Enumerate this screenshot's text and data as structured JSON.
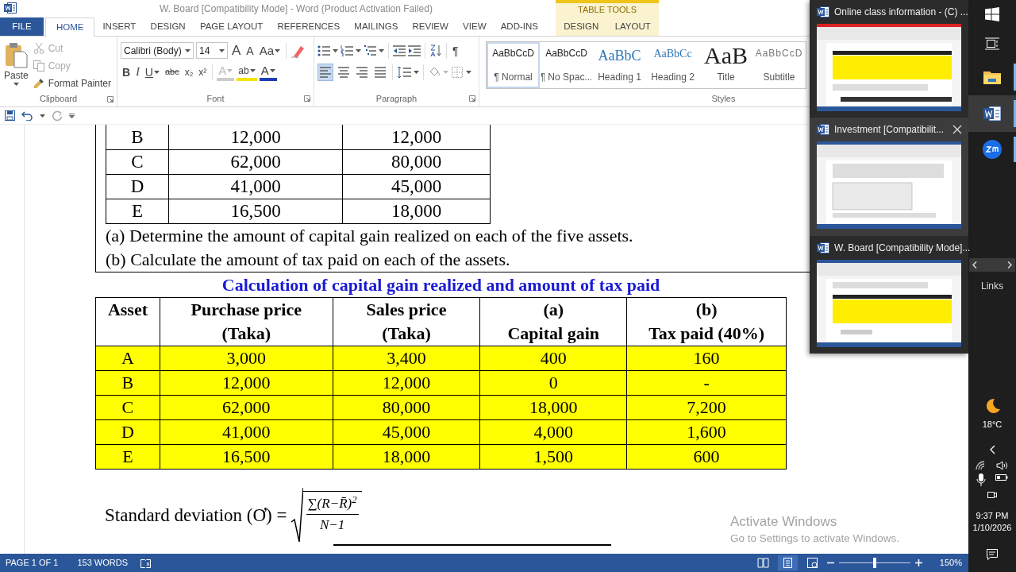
{
  "window": {
    "title": "W. Board [Compatibility Mode] - Word (Product Activation Failed)",
    "context_group": "TABLE TOOLS"
  },
  "tabs": [
    {
      "label": "FILE",
      "kind": "file",
      "selected": false
    },
    {
      "label": "HOME",
      "kind": "main",
      "selected": true
    },
    {
      "label": "INSERT",
      "kind": "main",
      "selected": false
    },
    {
      "label": "DESIGN",
      "kind": "main",
      "selected": false
    },
    {
      "label": "PAGE LAYOUT",
      "kind": "main",
      "selected": false
    },
    {
      "label": "REFERENCES",
      "kind": "main",
      "selected": false
    },
    {
      "label": "MAILINGS",
      "kind": "main",
      "selected": false
    },
    {
      "label": "REVIEW",
      "kind": "main",
      "selected": false
    },
    {
      "label": "VIEW",
      "kind": "main",
      "selected": false
    },
    {
      "label": "ADD-INS",
      "kind": "main",
      "selected": false
    },
    {
      "label": "DESIGN",
      "kind": "context",
      "selected": false
    },
    {
      "label": "LAYOUT",
      "kind": "context",
      "selected": false
    }
  ],
  "clipboard": {
    "paste": "Paste",
    "label": "Clipboard",
    "actions": [
      {
        "label": "Cut",
        "disabled": true
      },
      {
        "label": "Copy",
        "disabled": true
      },
      {
        "label": "Format Painter",
        "disabled": false
      }
    ]
  },
  "font": {
    "name": "Calibri (Body)",
    "size": "14",
    "label": "Font",
    "size_buttons": [
      "A",
      "A",
      "Aa"
    ],
    "format_buttons": [
      "B",
      "I",
      "U",
      "abc",
      "x₂",
      "x²"
    ],
    "effect_buttons": [
      "A",
      "ab",
      "A"
    ]
  },
  "paragraph": {
    "label": "Paragraph",
    "marks": "¶",
    "alignments": [
      {
        "selected": true
      },
      {
        "selected": false
      },
      {
        "selected": false
      },
      {
        "selected": false
      }
    ]
  },
  "styles": {
    "label": "Styles",
    "items": [
      {
        "sample": "AaBbCcD",
        "label": "¶ Normal",
        "kind": "normal",
        "selected": true
      },
      {
        "sample": "AaBbCcD",
        "label": "¶ No Spac...",
        "kind": "normal",
        "selected": false
      },
      {
        "sample": "AaBbC",
        "label": "Heading 1",
        "kind": "heading1",
        "selected": false
      },
      {
        "sample": "AaBbCc",
        "label": "Heading 2",
        "kind": "heading2",
        "selected": false
      },
      {
        "sample": "AaB",
        "label": "Title",
        "kind": "title",
        "selected": false
      },
      {
        "sample": "AaBbCcD",
        "label": "Subtitle",
        "kind": "subtitle",
        "selected": false
      }
    ]
  },
  "document": {
    "top_table": {
      "rows": [
        [
          "B",
          "12,000",
          "12,000"
        ],
        [
          "C",
          "62,000",
          "80,000"
        ],
        [
          "D",
          "41,000",
          "45,000"
        ],
        [
          "E",
          "16,500",
          "18,000"
        ]
      ]
    },
    "questions": [
      "(a) Determine the amount of capital gain realized on each of the five assets.",
      "(b) Calculate the amount of tax paid on each of the assets."
    ],
    "heading": "Calculation of capital gain realized and amount of tax paid",
    "table": {
      "highlighted": true,
      "header_rows": [
        [
          {
            "text": "Asset",
            "rowspan": 2
          },
          {
            "text": "Purchase price"
          },
          {
            "text": "Sales price"
          },
          {
            "text": "(a)"
          },
          {
            "text": "(b)"
          }
        ],
        [
          {
            "text": "(Taka)"
          },
          {
            "text": "(Taka)"
          },
          {
            "text": "Capital gain"
          },
          {
            "text": "Tax paid (40%)"
          }
        ]
      ],
      "rows": [
        [
          "A",
          "3,000",
          "3,400",
          "400",
          "160"
        ],
        [
          "B",
          "12,000",
          "12,000",
          "0",
          "-"
        ],
        [
          "C",
          "62,000",
          "80,000",
          "18,000",
          "7,200"
        ],
        [
          "D",
          "41,000",
          "45,000",
          "4,000",
          "1,600"
        ],
        [
          "E",
          "16,500",
          "18,000",
          "1,500",
          "600"
        ]
      ]
    },
    "formula": {
      "label": "Standard deviation (Ơ) =",
      "numerator": "∑(R−R̄)$^{2}$",
      "denominator": "N−1"
    }
  },
  "activation_notice": {
    "title": "Activate Windows",
    "text": "Go to Settings to activate Windows."
  },
  "status_bar": {
    "page": "PAGE 1 OF 1",
    "words": "153 WORDS",
    "views": [
      {
        "selected": false
      },
      {
        "selected": true
      },
      {
        "selected": false
      }
    ],
    "zoom": {
      "level": 0.5,
      "reading": "150%"
    }
  },
  "switcher": [
    {
      "title": "Online class information - (C) ...",
      "hovered": false
    },
    {
      "title": "Investment [Compatibilit...",
      "hovered": true
    },
    {
      "title": "W. Board [Compatibility Mode]...",
      "hovered": false
    }
  ],
  "taskbar": {
    "apps": [
      {
        "kind": "start",
        "selected": false
      },
      {
        "kind": "task_view",
        "selected": false
      },
      {
        "kind": "explorer",
        "running": true,
        "selected": false
      },
      {
        "kind": "word",
        "running": true,
        "selected": true
      },
      {
        "kind": "zoom",
        "running": true,
        "selected": false
      }
    ],
    "links": "Links",
    "weather": "18°C",
    "time": "9:37 PM",
    "date": "1/10/2026"
  }
}
